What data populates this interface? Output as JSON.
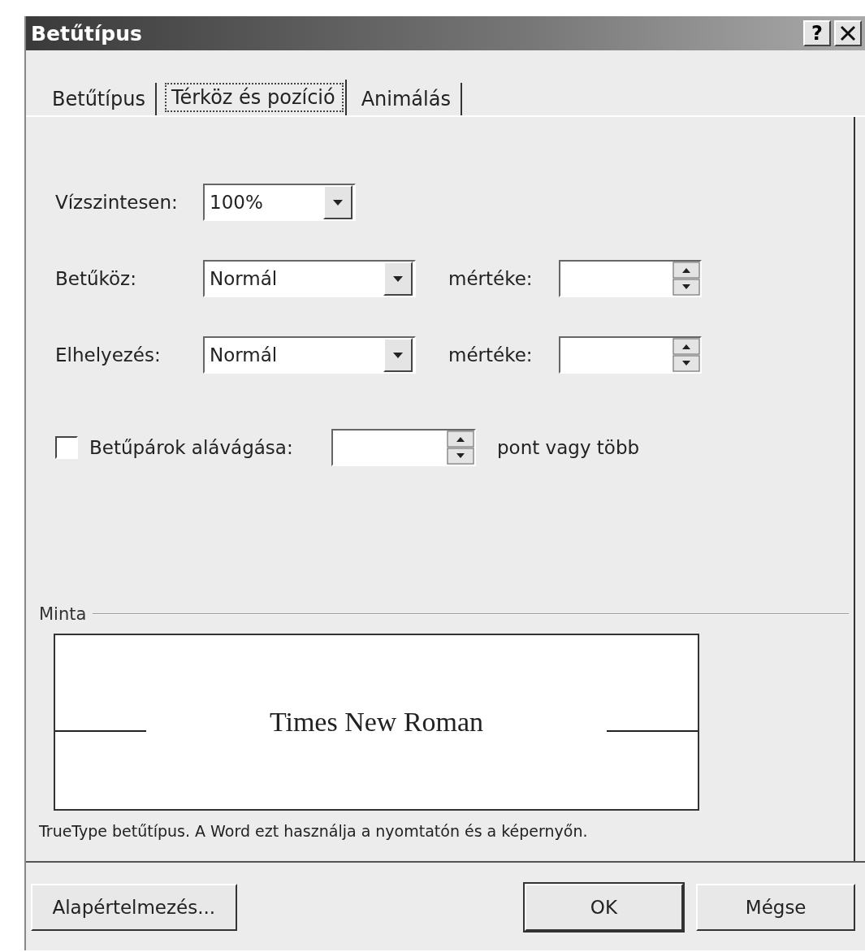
{
  "window": {
    "title": "Betűtípus",
    "help": "?"
  },
  "tabs": [
    {
      "label": "Betűtípus",
      "selected": false
    },
    {
      "label": "Térköz és pozíció",
      "selected": true
    },
    {
      "label": "Animálás",
      "selected": false
    }
  ],
  "rows": [
    {
      "kind": "combo",
      "label": "Vízszintesen:",
      "value": "100%"
    },
    {
      "kind": "combo-spin",
      "label": "Betűköz:",
      "value": "Normál",
      "spin_label": "mértéke:"
    },
    {
      "kind": "combo-spin",
      "label": "Elhelyezés:",
      "value": "Normál",
      "spin_label": "mértéke:"
    },
    {
      "kind": "check-spin",
      "label": "Betűpárok alávágása:",
      "checked": false,
      "suffix": "pont vagy több"
    }
  ],
  "preview": {
    "group_label": "Minta",
    "sample": "Times New Roman"
  },
  "note": "TrueType betűtípus. A Word ezt használja a nyomtatón és a képernyőn.",
  "buttons": [
    {
      "label": "Alapértelmezés...",
      "default": false
    },
    {
      "label": "OK",
      "default": true
    },
    {
      "label": "Mégse",
      "default": false
    }
  ]
}
